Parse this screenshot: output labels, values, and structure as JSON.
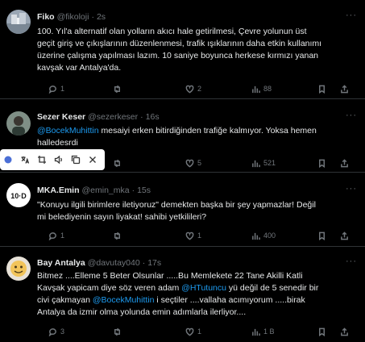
{
  "tweets": [
    {
      "name": "Fiko",
      "handle": "@fikoloji",
      "time": "2s",
      "lines": [
        "100. Yıl'a alternatif olan yolların akıcı hale getirilmesi, Çevre yolunun üst",
        "geçit giriş ve çıkışlarının düzenlenmesi, trafik ışıklarının daha etkin kullanımı",
        "üzerine çalışma yapılması lazım. 10 saniye boyunca herkese kırmızı yanan",
        "kavşak var Antalya'da."
      ],
      "replies": "1",
      "retweets": "",
      "likes": "2",
      "views": "88"
    },
    {
      "name": "Sezer Keser",
      "handle": "@sezerkeser",
      "time": "16s",
      "mention": "@BocekMuhittin",
      "lines": [
        " mesaiyi erken bitirdiğinden trafiğe kalmıyor. Yoksa hemen",
        "halledesrdi"
      ],
      "replies": "",
      "retweets": "",
      "likes": "5",
      "views": "521"
    },
    {
      "name": "MKA.Emin",
      "handle": "@emin_mka",
      "time": "15s",
      "lines": [
        "\"Konuyu ilgili birimlere iletiyoruz\" demekten başka bir şey yapmazlar! Değil",
        "mi belediyenin sayın liyakat! sahibi yetkilileri?"
      ],
      "replies": "1",
      "retweets": "",
      "likes": "1",
      "views": "400"
    },
    {
      "name": "Bay Antalya",
      "handle": "@davutay040",
      "time": "17s",
      "line1": "Bitmez ....Elleme 5 Beter Olsunlar .....Bu Memlekete 22 Tane Akilli Katli",
      "line2a": "Kavşak yapicam diye söz veren adam ",
      "mention1": "@HTutuncu",
      "line2b": " yü değil de 5 senedir bir",
      "line3a": "civi çakmayan ",
      "mention2": "@BocekMuhittin",
      "line3b": " i seçtiler ....vallaha acımıyorum  .....birak",
      "line4": "Antalya da izmir olma yolunda emin adımlarla ilerliyor....",
      "replies": "3",
      "retweets": "",
      "likes": "1",
      "views": "1 B"
    }
  ],
  "more_label": "···",
  "colors": {
    "accent": "#1d9bf0",
    "muted": "#71767b",
    "text": "#e7e9ea",
    "background": "#000000"
  },
  "popup_icons": [
    "extension-icon",
    "translate-icon",
    "crop-icon",
    "speaker-icon",
    "copy-icon",
    "close-icon"
  ]
}
